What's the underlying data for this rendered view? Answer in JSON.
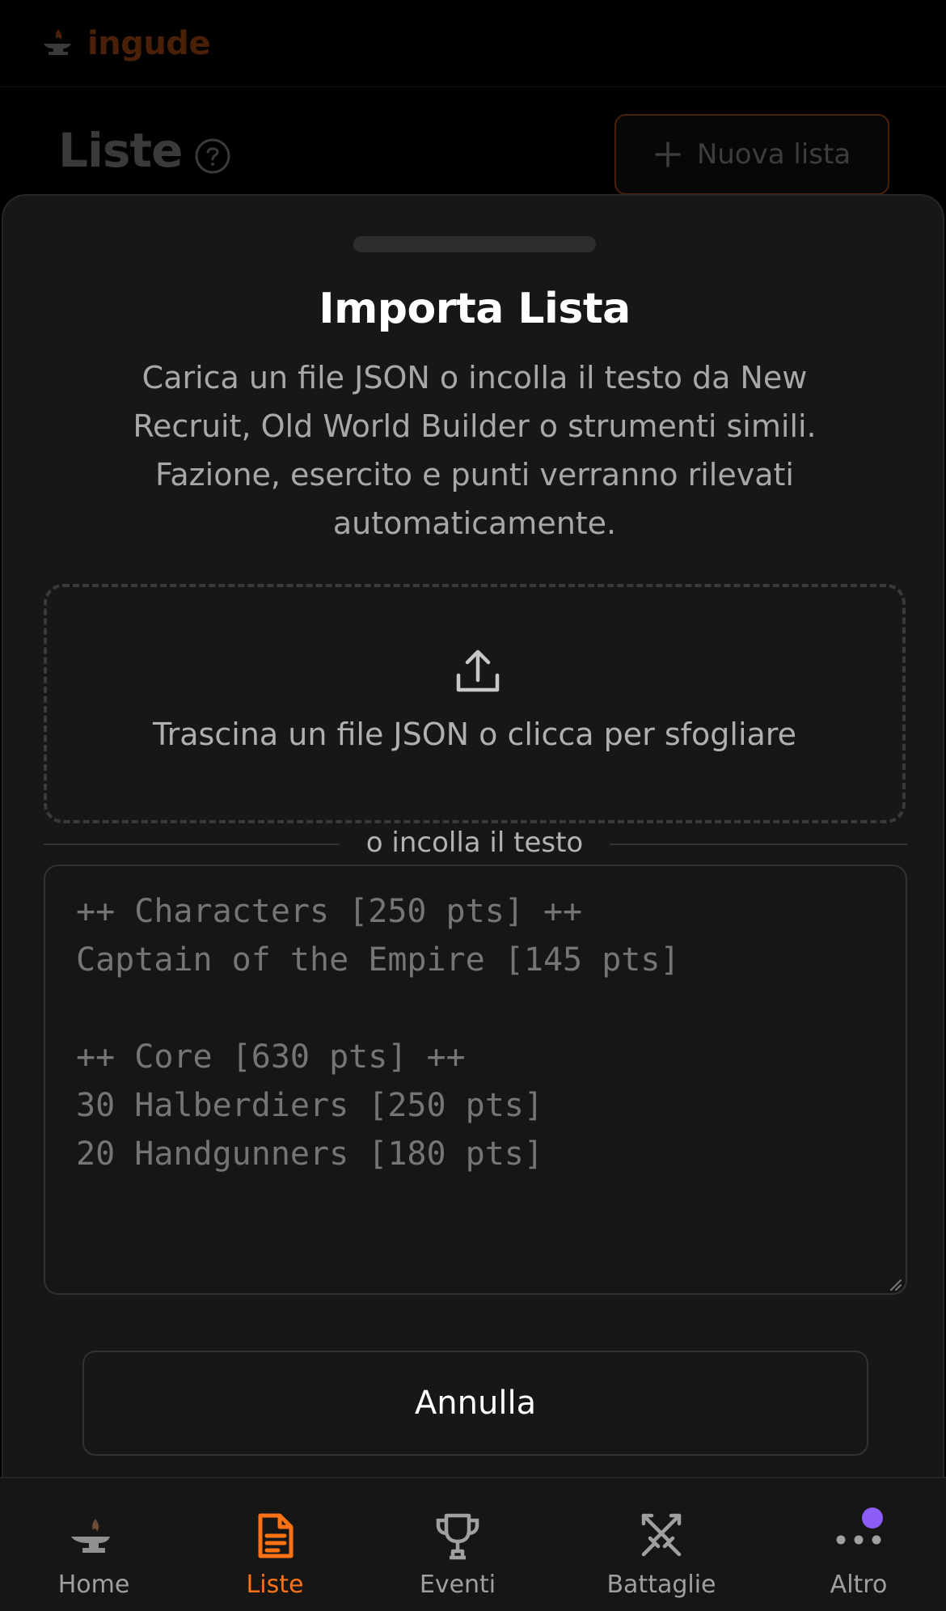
{
  "app": {
    "brand_name": "ingude",
    "brand_color": "#f97316"
  },
  "page": {
    "title": "Liste",
    "new_list_label": "Nuova lista",
    "help_icon": "question-circle-icon"
  },
  "sheet": {
    "title": "Importa Lista",
    "description": "Carica un file JSON o incolla il testo da New Recruit, Old World Builder o strumenti simili. Fazione, esercito e punti verranno rilevati automaticamente.",
    "dropzone": {
      "icon": "upload-icon",
      "label": "Trascina un file JSON o clicca per sfogliare"
    },
    "divider_label": "o incolla il testo",
    "paste_placeholder": "++ Characters [250 pts] ++\nCaptain of the Empire [145 pts]\n\n++ Core [630 pts] ++\n30 Halberdiers [250 pts]\n20 Handgunners [180 pts]",
    "paste_value": "",
    "cancel_label": "Annulla"
  },
  "nav": {
    "items": [
      {
        "label": "Home",
        "icon": "anvil-icon",
        "active": false
      },
      {
        "label": "Liste",
        "icon": "document-icon",
        "active": true
      },
      {
        "label": "Eventi",
        "icon": "trophy-icon",
        "active": false
      },
      {
        "label": "Battaglie",
        "icon": "crossed-swords-icon",
        "active": false
      },
      {
        "label": "Altro",
        "icon": "more-dots-icon",
        "active": false,
        "badge": true
      }
    ],
    "active_color": "#f97316",
    "badge_color": "#8b5cf6"
  }
}
